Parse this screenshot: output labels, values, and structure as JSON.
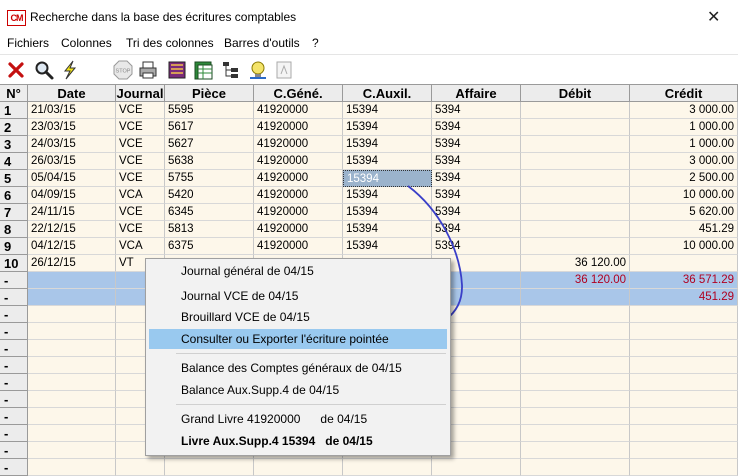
{
  "window": {
    "title": "Recherche dans la base des écritures comptables",
    "logo_text": "CM",
    "close_glyph": "✕"
  },
  "menu": [
    "Fichiers",
    "Colonnes",
    "Tri des colonnes",
    "Barres d'outils",
    "?"
  ],
  "toolbar": {
    "icons": [
      "close-icon",
      "search-icon",
      "lightning-icon",
      "stop-icon",
      "print-icon",
      "book-icon",
      "spreadsheet-icon",
      "tree-icon",
      "lamp-icon",
      "export-icon"
    ],
    "stop_label": "STOP"
  },
  "table": {
    "columns": [
      "N°",
      "Date",
      "Journal",
      "Pièce",
      "C.Géné.",
      "C.Auxil.",
      "Affaire",
      "Débit",
      "Crédit"
    ],
    "rows": [
      {
        "n": "1",
        "date": "21/03/15",
        "journal": "VCE",
        "piece": "5595",
        "gene": "41920000",
        "aux": "15394",
        "affaire": "5394",
        "debit": "",
        "credit": "3 000.00"
      },
      {
        "n": "2",
        "date": "23/03/15",
        "journal": "VCE",
        "piece": "5617",
        "gene": "41920000",
        "aux": "15394",
        "affaire": "5394",
        "debit": "",
        "credit": "1 000.00"
      },
      {
        "n": "3",
        "date": "24/03/15",
        "journal": "VCE",
        "piece": "5627",
        "gene": "41920000",
        "aux": "15394",
        "affaire": "5394",
        "debit": "",
        "credit": "1 000.00"
      },
      {
        "n": "4",
        "date": "26/03/15",
        "journal": "VCE",
        "piece": "5638",
        "gene": "41920000",
        "aux": "15394",
        "affaire": "5394",
        "debit": "",
        "credit": "3 000.00"
      },
      {
        "n": "5",
        "date": "05/04/15",
        "journal": "VCE",
        "piece": "5755",
        "gene": "41920000",
        "aux": "15394",
        "affaire": "5394",
        "debit": "",
        "credit": "2 500.00"
      },
      {
        "n": "6",
        "date": "04/09/15",
        "journal": "VCA",
        "piece": "5420",
        "gene": "41920000",
        "aux": "15394",
        "affaire": "5394",
        "debit": "",
        "credit": "10 000.00"
      },
      {
        "n": "7",
        "date": "24/11/15",
        "journal": "VCE",
        "piece": "6345",
        "gene": "41920000",
        "aux": "15394",
        "affaire": "5394",
        "debit": "",
        "credit": "5 620.00"
      },
      {
        "n": "8",
        "date": "22/12/15",
        "journal": "VCE",
        "piece": "5813",
        "gene": "41920000",
        "aux": "15394",
        "affaire": "5394",
        "debit": "",
        "credit": "451.29"
      },
      {
        "n": "9",
        "date": "04/12/15",
        "journal": "VCA",
        "piece": "6375",
        "gene": "41920000",
        "aux": "15394",
        "affaire": "5394",
        "debit": "",
        "credit": "10 000.00"
      },
      {
        "n": "10",
        "date": "26/12/15",
        "journal": "VT",
        "piece": "",
        "gene": "",
        "aux": "",
        "affaire": "",
        "debit": "36 120.00",
        "credit": ""
      }
    ],
    "totals": [
      {
        "n": "-",
        "debit": "36 120.00",
        "credit": "36 571.29"
      },
      {
        "n": "-",
        "debit": "",
        "credit": "451.29"
      }
    ],
    "empty_row_marker": "-"
  },
  "context_menu": {
    "items": [
      "Journal général de 04/15",
      "Journal VCE de 04/15",
      "Brouillard VCE de 04/15",
      "Consulter ou Exporter l'écriture pointée",
      "Balance des Comptes généraux de 04/15",
      "Balance Aux.Supp.4 de 04/15",
      "Grand Livre 41920000      de 04/15",
      "Livre Aux.Supp.4 15394   de 04/15"
    ],
    "highlighted": "Consulter ou Exporter l'écriture pointée"
  },
  "colors": {
    "accent_highlight": "#99c9ef",
    "total_row": "#a9c6e9",
    "red_value": "#b00020",
    "row_bg": "#fdf7ea",
    "annotation_arrow": "#3a3fc8"
  }
}
